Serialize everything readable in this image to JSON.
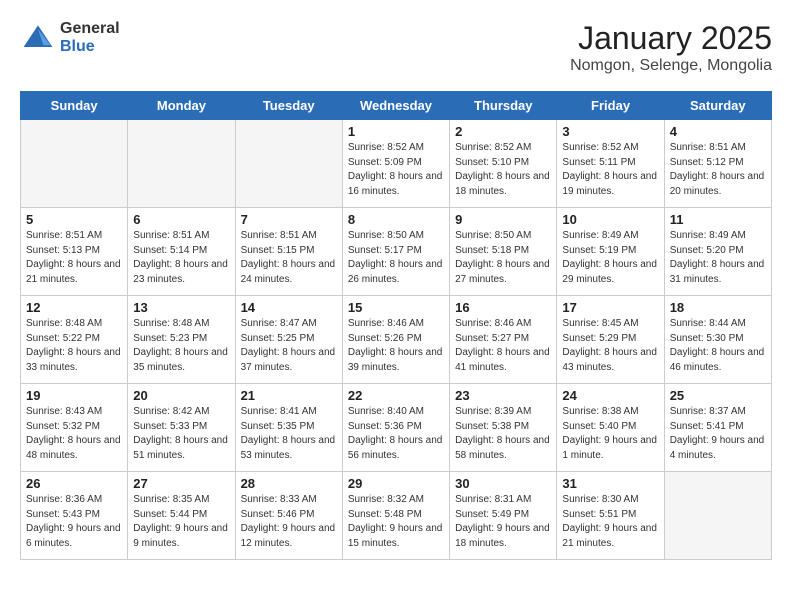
{
  "logo": {
    "general": "General",
    "blue": "Blue"
  },
  "title": "January 2025",
  "subtitle": "Nomgon, Selenge, Mongolia",
  "weekdays": [
    "Sunday",
    "Monday",
    "Tuesday",
    "Wednesday",
    "Thursday",
    "Friday",
    "Saturday"
  ],
  "weeks": [
    [
      {
        "num": "",
        "sunrise": "",
        "sunset": "",
        "daylight": "",
        "empty": true
      },
      {
        "num": "",
        "sunrise": "",
        "sunset": "",
        "daylight": "",
        "empty": true
      },
      {
        "num": "",
        "sunrise": "",
        "sunset": "",
        "daylight": "",
        "empty": true
      },
      {
        "num": "1",
        "sunrise": "Sunrise: 8:52 AM",
        "sunset": "Sunset: 5:09 PM",
        "daylight": "Daylight: 8 hours and 16 minutes."
      },
      {
        "num": "2",
        "sunrise": "Sunrise: 8:52 AM",
        "sunset": "Sunset: 5:10 PM",
        "daylight": "Daylight: 8 hours and 18 minutes."
      },
      {
        "num": "3",
        "sunrise": "Sunrise: 8:52 AM",
        "sunset": "Sunset: 5:11 PM",
        "daylight": "Daylight: 8 hours and 19 minutes."
      },
      {
        "num": "4",
        "sunrise": "Sunrise: 8:51 AM",
        "sunset": "Sunset: 5:12 PM",
        "daylight": "Daylight: 8 hours and 20 minutes."
      }
    ],
    [
      {
        "num": "5",
        "sunrise": "Sunrise: 8:51 AM",
        "sunset": "Sunset: 5:13 PM",
        "daylight": "Daylight: 8 hours and 21 minutes."
      },
      {
        "num": "6",
        "sunrise": "Sunrise: 8:51 AM",
        "sunset": "Sunset: 5:14 PM",
        "daylight": "Daylight: 8 hours and 23 minutes."
      },
      {
        "num": "7",
        "sunrise": "Sunrise: 8:51 AM",
        "sunset": "Sunset: 5:15 PM",
        "daylight": "Daylight: 8 hours and 24 minutes."
      },
      {
        "num": "8",
        "sunrise": "Sunrise: 8:50 AM",
        "sunset": "Sunset: 5:17 PM",
        "daylight": "Daylight: 8 hours and 26 minutes."
      },
      {
        "num": "9",
        "sunrise": "Sunrise: 8:50 AM",
        "sunset": "Sunset: 5:18 PM",
        "daylight": "Daylight: 8 hours and 27 minutes."
      },
      {
        "num": "10",
        "sunrise": "Sunrise: 8:49 AM",
        "sunset": "Sunset: 5:19 PM",
        "daylight": "Daylight: 8 hours and 29 minutes."
      },
      {
        "num": "11",
        "sunrise": "Sunrise: 8:49 AM",
        "sunset": "Sunset: 5:20 PM",
        "daylight": "Daylight: 8 hours and 31 minutes."
      }
    ],
    [
      {
        "num": "12",
        "sunrise": "Sunrise: 8:48 AM",
        "sunset": "Sunset: 5:22 PM",
        "daylight": "Daylight: 8 hours and 33 minutes."
      },
      {
        "num": "13",
        "sunrise": "Sunrise: 8:48 AM",
        "sunset": "Sunset: 5:23 PM",
        "daylight": "Daylight: 8 hours and 35 minutes."
      },
      {
        "num": "14",
        "sunrise": "Sunrise: 8:47 AM",
        "sunset": "Sunset: 5:25 PM",
        "daylight": "Daylight: 8 hours and 37 minutes."
      },
      {
        "num": "15",
        "sunrise": "Sunrise: 8:46 AM",
        "sunset": "Sunset: 5:26 PM",
        "daylight": "Daylight: 8 hours and 39 minutes."
      },
      {
        "num": "16",
        "sunrise": "Sunrise: 8:46 AM",
        "sunset": "Sunset: 5:27 PM",
        "daylight": "Daylight: 8 hours and 41 minutes."
      },
      {
        "num": "17",
        "sunrise": "Sunrise: 8:45 AM",
        "sunset": "Sunset: 5:29 PM",
        "daylight": "Daylight: 8 hours and 43 minutes."
      },
      {
        "num": "18",
        "sunrise": "Sunrise: 8:44 AM",
        "sunset": "Sunset: 5:30 PM",
        "daylight": "Daylight: 8 hours and 46 minutes."
      }
    ],
    [
      {
        "num": "19",
        "sunrise": "Sunrise: 8:43 AM",
        "sunset": "Sunset: 5:32 PM",
        "daylight": "Daylight: 8 hours and 48 minutes."
      },
      {
        "num": "20",
        "sunrise": "Sunrise: 8:42 AM",
        "sunset": "Sunset: 5:33 PM",
        "daylight": "Daylight: 8 hours and 51 minutes."
      },
      {
        "num": "21",
        "sunrise": "Sunrise: 8:41 AM",
        "sunset": "Sunset: 5:35 PM",
        "daylight": "Daylight: 8 hours and 53 minutes."
      },
      {
        "num": "22",
        "sunrise": "Sunrise: 8:40 AM",
        "sunset": "Sunset: 5:36 PM",
        "daylight": "Daylight: 8 hours and 56 minutes."
      },
      {
        "num": "23",
        "sunrise": "Sunrise: 8:39 AM",
        "sunset": "Sunset: 5:38 PM",
        "daylight": "Daylight: 8 hours and 58 minutes."
      },
      {
        "num": "24",
        "sunrise": "Sunrise: 8:38 AM",
        "sunset": "Sunset: 5:40 PM",
        "daylight": "Daylight: 9 hours and 1 minute."
      },
      {
        "num": "25",
        "sunrise": "Sunrise: 8:37 AM",
        "sunset": "Sunset: 5:41 PM",
        "daylight": "Daylight: 9 hours and 4 minutes."
      }
    ],
    [
      {
        "num": "26",
        "sunrise": "Sunrise: 8:36 AM",
        "sunset": "Sunset: 5:43 PM",
        "daylight": "Daylight: 9 hours and 6 minutes."
      },
      {
        "num": "27",
        "sunrise": "Sunrise: 8:35 AM",
        "sunset": "Sunset: 5:44 PM",
        "daylight": "Daylight: 9 hours and 9 minutes."
      },
      {
        "num": "28",
        "sunrise": "Sunrise: 8:33 AM",
        "sunset": "Sunset: 5:46 PM",
        "daylight": "Daylight: 9 hours and 12 minutes."
      },
      {
        "num": "29",
        "sunrise": "Sunrise: 8:32 AM",
        "sunset": "Sunset: 5:48 PM",
        "daylight": "Daylight: 9 hours and 15 minutes."
      },
      {
        "num": "30",
        "sunrise": "Sunrise: 8:31 AM",
        "sunset": "Sunset: 5:49 PM",
        "daylight": "Daylight: 9 hours and 18 minutes."
      },
      {
        "num": "31",
        "sunrise": "Sunrise: 8:30 AM",
        "sunset": "Sunset: 5:51 PM",
        "daylight": "Daylight: 9 hours and 21 minutes."
      },
      {
        "num": "",
        "sunrise": "",
        "sunset": "",
        "daylight": "",
        "empty": true
      }
    ]
  ]
}
